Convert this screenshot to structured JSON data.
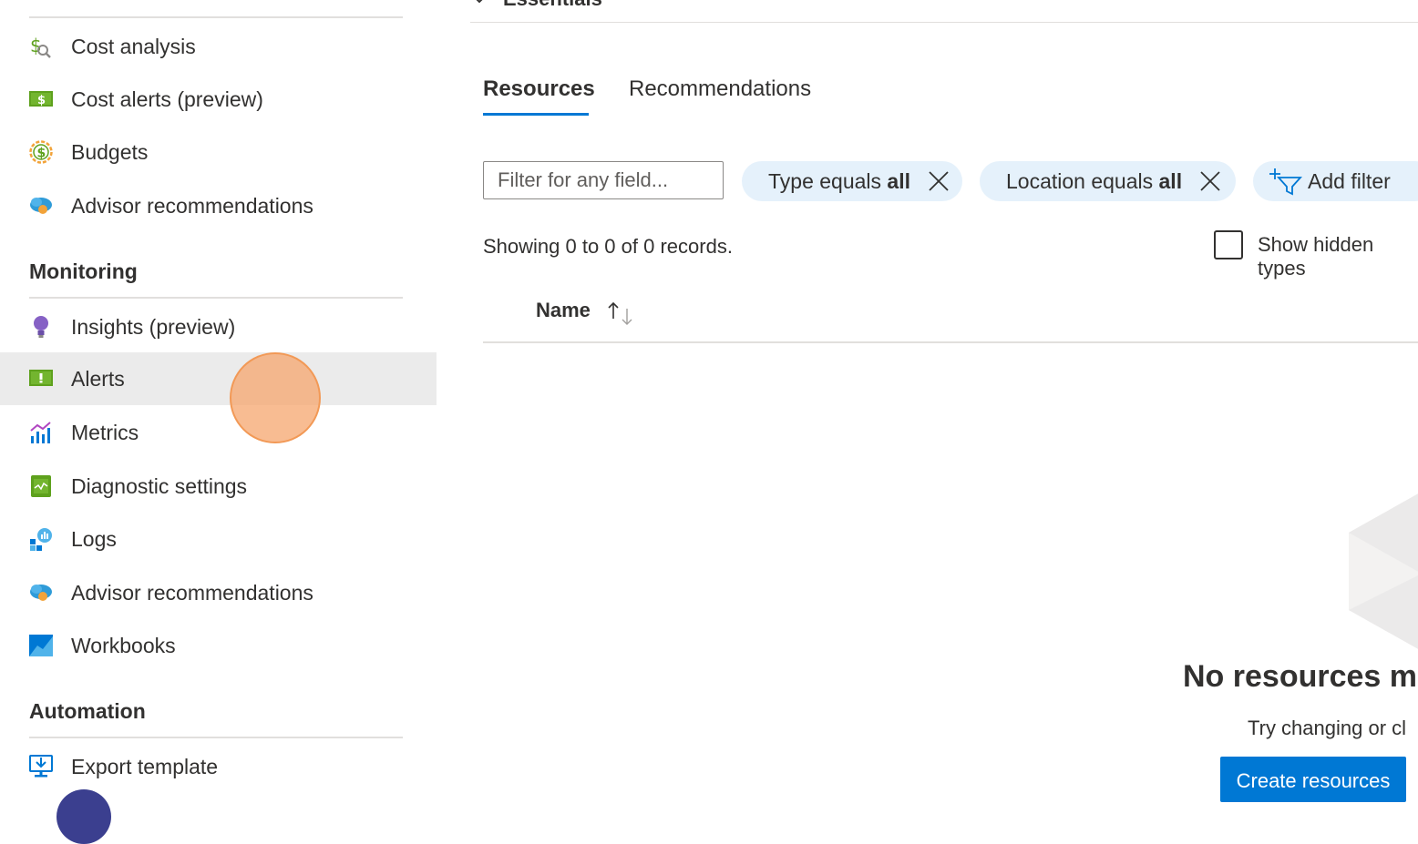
{
  "sidebar": {
    "cost_items": [
      {
        "label": "Cost analysis",
        "icon": "cost-analysis-icon"
      },
      {
        "label": "Cost alerts (preview)",
        "icon": "cost-alerts-icon"
      },
      {
        "label": "Budgets",
        "icon": "budgets-icon"
      },
      {
        "label": "Advisor recommendations",
        "icon": "advisor-icon"
      }
    ],
    "monitoring": {
      "heading": "Monitoring",
      "items": [
        {
          "label": "Insights (preview)",
          "icon": "insights-icon"
        },
        {
          "label": "Alerts",
          "icon": "alerts-icon",
          "selected": true
        },
        {
          "label": "Metrics",
          "icon": "metrics-icon"
        },
        {
          "label": "Diagnostic settings",
          "icon": "diagnostic-settings-icon"
        },
        {
          "label": "Logs",
          "icon": "logs-icon"
        },
        {
          "label": "Advisor recommendations",
          "icon": "advisor-icon"
        },
        {
          "label": "Workbooks",
          "icon": "workbooks-icon"
        }
      ]
    },
    "automation": {
      "heading": "Automation",
      "items": [
        {
          "label": "Export template",
          "icon": "export-template-icon"
        }
      ]
    }
  },
  "main": {
    "essentials_label": "Essentials",
    "tabs": [
      {
        "label": "Resources",
        "active": true
      },
      {
        "label": "Recommendations",
        "active": false
      }
    ],
    "filter": {
      "placeholder": "Filter for any field...",
      "pills": [
        {
          "prefix": "Type equals ",
          "value": "all"
        },
        {
          "prefix": "Location equals ",
          "value": "all"
        }
      ],
      "add_filter_label": "Add filter"
    },
    "records_text": "Showing 0 to 0 of 0 records.",
    "show_hidden_label": "Show hidden types",
    "show_hidden_checked": false,
    "table": {
      "columns": [
        {
          "label": "Name",
          "sort": "ascending"
        }
      ]
    },
    "empty_state": {
      "title": "No resources m",
      "subtitle": "Try changing or cl",
      "button_label": "Create resources"
    }
  },
  "colors": {
    "accent": "#0078d4",
    "pill_bg": "#e5f1fb",
    "selected_bg": "#ebebeb",
    "cursor_highlight": "#f5a66e"
  }
}
